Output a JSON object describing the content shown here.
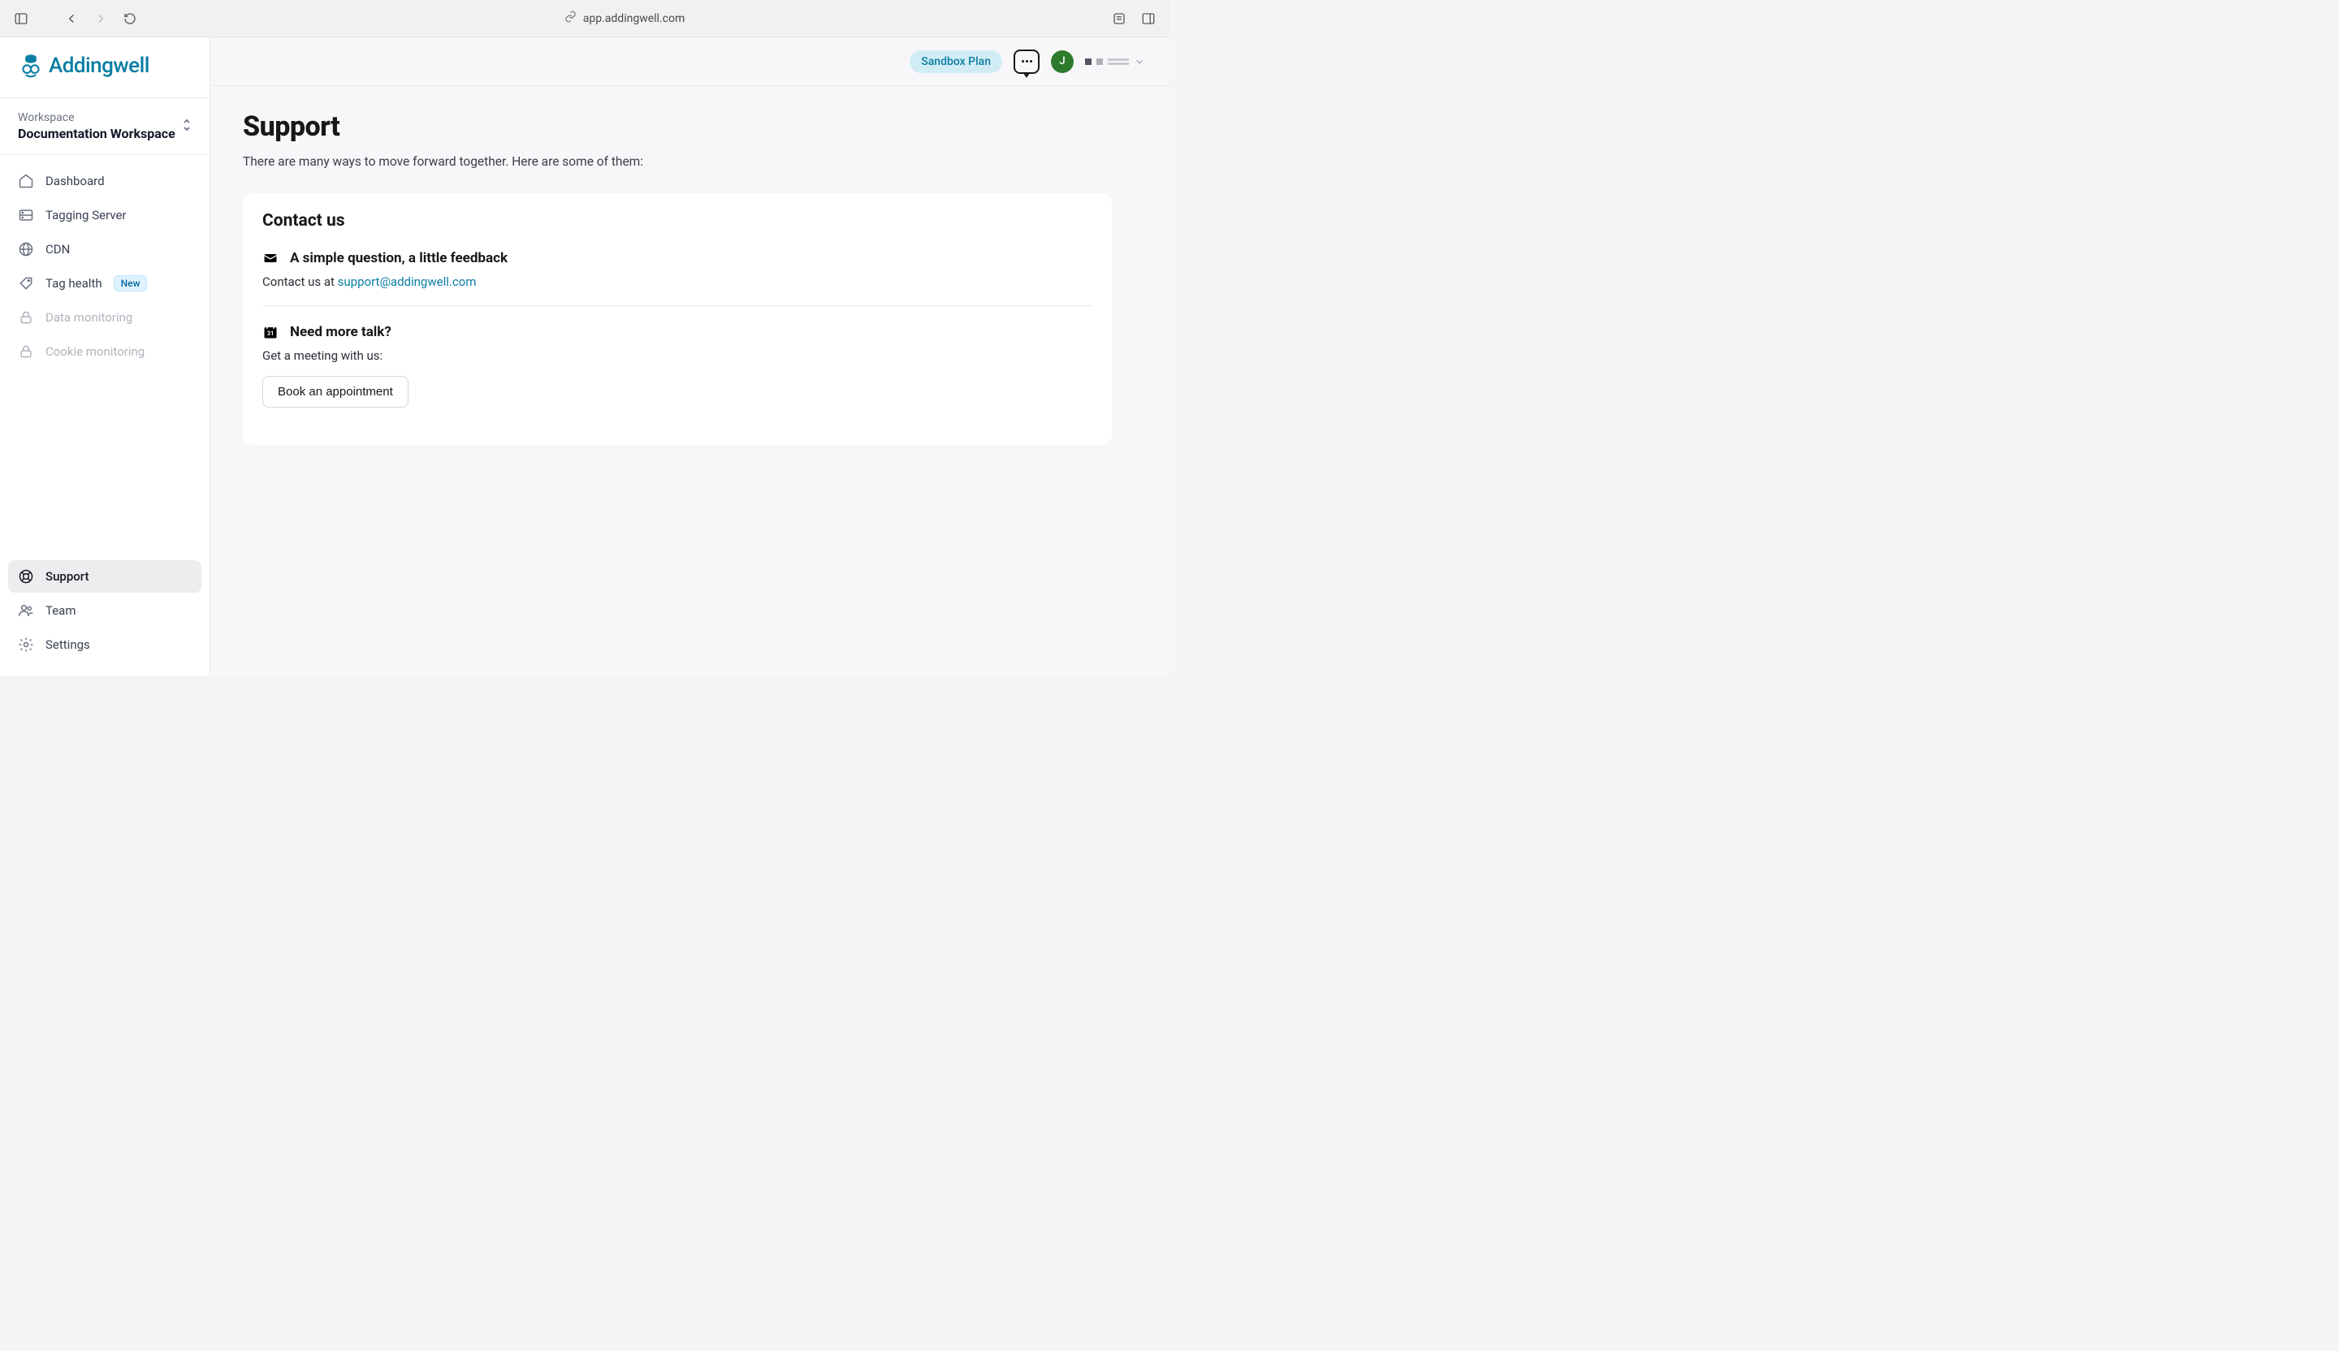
{
  "browser": {
    "url": "app.addingwell.com"
  },
  "brand": {
    "name": "Addingwell"
  },
  "workspace": {
    "label": "Workspace",
    "name": "Documentation Workspace"
  },
  "nav": {
    "top": [
      {
        "label": "Dashboard"
      },
      {
        "label": "Tagging Server"
      },
      {
        "label": "CDN"
      },
      {
        "label": "Tag health",
        "badge": "New"
      },
      {
        "label": "Data monitoring"
      },
      {
        "label": "Cookie monitoring"
      }
    ],
    "bottom": [
      {
        "label": "Support"
      },
      {
        "label": "Team"
      },
      {
        "label": "Settings"
      }
    ]
  },
  "topbar": {
    "plan": "Sandbox Plan",
    "avatar_initial": "J"
  },
  "page": {
    "title": "Support",
    "description": "There are many ways to move forward together. Here are some of them:"
  },
  "contact_card": {
    "title": "Contact us",
    "section1": {
      "title": "A simple question, a little feedback",
      "prefix": "Contact us at ",
      "email": "support@addingwell.com"
    },
    "section2": {
      "title": "Need more talk?",
      "text": "Get a meeting with us:",
      "button": "Book an appointment"
    }
  }
}
